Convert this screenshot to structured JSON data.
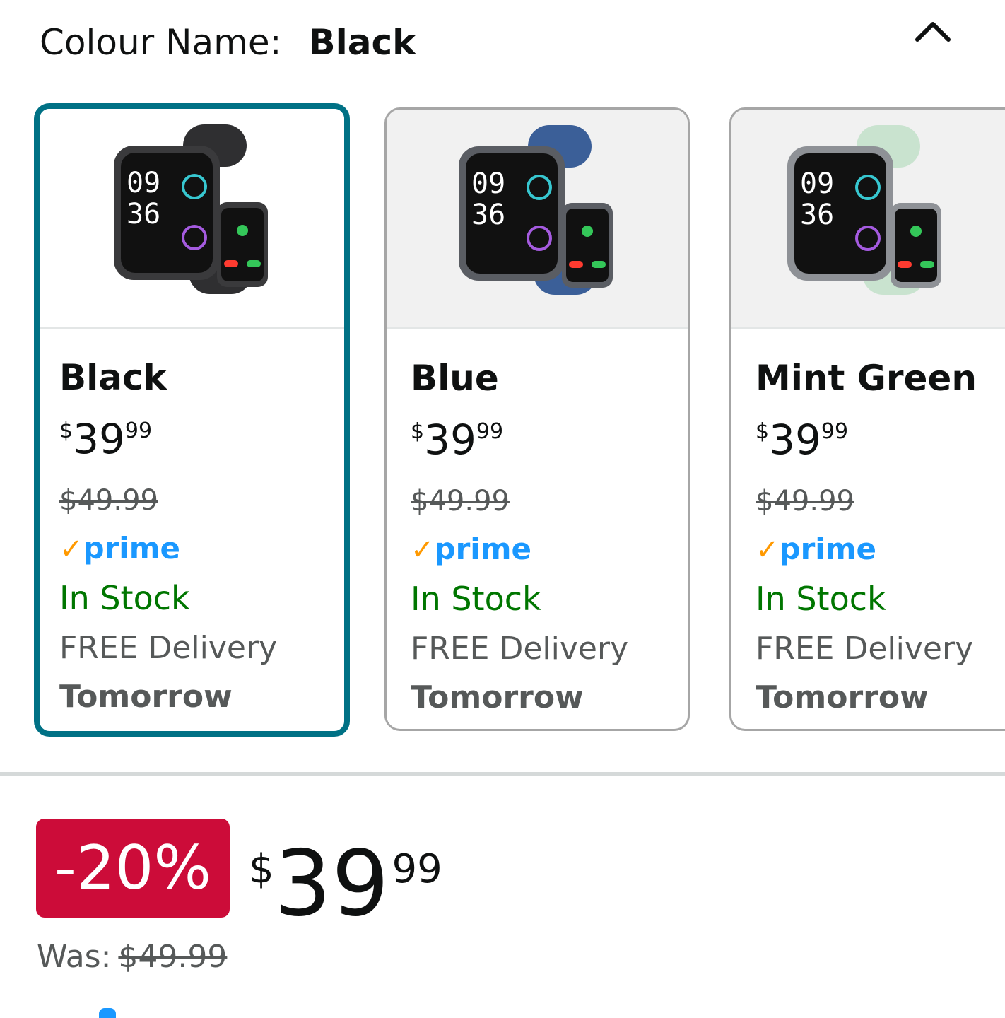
{
  "header": {
    "label": "Colour Name:",
    "value": "Black"
  },
  "variants": [
    {
      "name": "Black",
      "currency": "$",
      "whole": "39",
      "fraction": "99",
      "old_price": "$49.99",
      "prime_check": "✓",
      "prime": "prime",
      "stock": "In Stock",
      "delivery": "FREE Delivery",
      "when": "Tomorrow",
      "band_color": "#2f2f31"
    },
    {
      "name": "Blue",
      "currency": "$",
      "whole": "39",
      "fraction": "99",
      "old_price": "$49.99",
      "prime_check": "✓",
      "prime": "prime",
      "stock": "In Stock",
      "delivery": "FREE Delivery",
      "when": "Tomorrow",
      "band_color": "#3b5f98"
    },
    {
      "name": "Mint Green",
      "currency": "$",
      "whole": "39",
      "fraction": "99",
      "old_price": "$49.99",
      "prime_check": "✓",
      "prime": "prime",
      "stock": "In Stock",
      "delivery": "FREE Delivery",
      "when": "Tomorrow",
      "band_color": "#c9e3cf"
    }
  ],
  "summary": {
    "discount": "-20%",
    "currency": "$",
    "whole": "39",
    "fraction": "99",
    "was_label": "Was:",
    "was_price": "$49.99"
  },
  "watch_face": {
    "hour": "09",
    "minute": "36"
  },
  "colors": {
    "selected_border": "#007185",
    "discount_bg": "#cc0c39",
    "in_stock": "#007600",
    "prime_blue": "#1a98ff",
    "prime_check": "#ff9900"
  }
}
